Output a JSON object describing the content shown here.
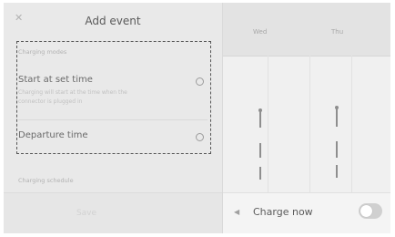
{
  "dialog": {
    "title": "Add event",
    "section_label": "Charging modes",
    "options": [
      {
        "label": "Start at set time",
        "description": "Charging will start at the time when the connector is plugged in"
      },
      {
        "label": "Departure time"
      }
    ],
    "schedule_label": "Charging schedule",
    "save_label": "Save"
  },
  "schedule": {
    "days": [
      "Wed",
      "Thu"
    ],
    "charge_now_label": "Charge now",
    "charge_now_on": false
  }
}
